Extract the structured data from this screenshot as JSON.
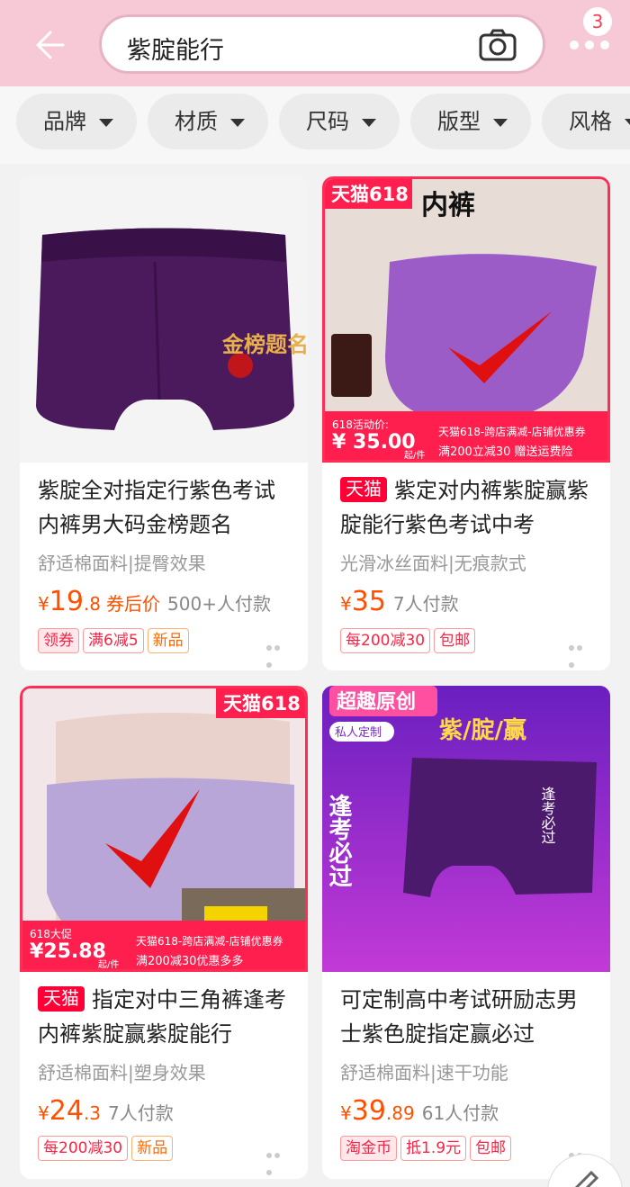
{
  "header": {
    "search_value": "紫腚能行",
    "cart_badge": "3"
  },
  "filters": [
    "品牌",
    "材质",
    "尺码",
    "版型",
    "风格"
  ],
  "products": [
    {
      "title": "紫腚全对指定行紫色考试内裤男大码金榜题名",
      "tmall": "",
      "subtitle": "舒适棉面料|提臀效果",
      "price_int": "19",
      "price_dec": ".8",
      "price_tip": "券后价",
      "sales": "500+人付款",
      "tags": [
        "领券",
        "满6减5",
        "新品"
      ],
      "image_text": "金榜题名"
    },
    {
      "title": "紫定对内裤紫腚赢紫腚能行紫色考试中考",
      "tmall": "天猫",
      "subtitle": "光滑冰丝面料|无痕款式",
      "price_int": "35",
      "price_dec": "",
      "price_tip": "",
      "sales": "7人付款",
      "tags": [
        "每200减30",
        "包邮"
      ],
      "image_badge": "天猫618",
      "image_top_text": "内裤",
      "promo": {
        "label": "618活动价:",
        "price": "35.00",
        "unit": "起/件",
        "line1": "天猫618-跨店满减-店铺优惠券",
        "line2": "满200立减30  赠送运费险"
      }
    },
    {
      "title": "指定对中三角裤逢考内裤紫腚赢紫腚能行",
      "tmall": "天猫",
      "subtitle": "舒适棉面料|塑身效果",
      "price_int": "24",
      "price_dec": ".3",
      "price_tip": "",
      "sales": "7人付款",
      "tags": [
        "每200减30",
        "新品"
      ],
      "image_badge": "天猫618",
      "promo": {
        "label": "618大促",
        "price": "25.88",
        "unit": "起/件",
        "line1": "天猫618-跨店满减-店铺优惠券",
        "line2": "满200减30优惠多多"
      }
    },
    {
      "title": "可定制高中考试研励志男士紫色腚指定赢必过",
      "tmall": "",
      "subtitle": "舒适棉面料|速干功能",
      "price_int": "39",
      "price_dec": ".89",
      "price_tip": "",
      "sales": "61人付款",
      "tags": [
        "淘金币",
        "抵1.9元",
        "包邮"
      ],
      "image_badge": "超趣原创",
      "image_sub_badge": "私人定制",
      "image_heading": "紫/腚/赢",
      "image_left_text": "逢考必过",
      "image_right_text": "逢考必过"
    }
  ],
  "colors": {
    "header_bg": "#f7c9d6",
    "price": "#ff5000",
    "tmall": "#ff0036",
    "purple": "#5a2168"
  }
}
